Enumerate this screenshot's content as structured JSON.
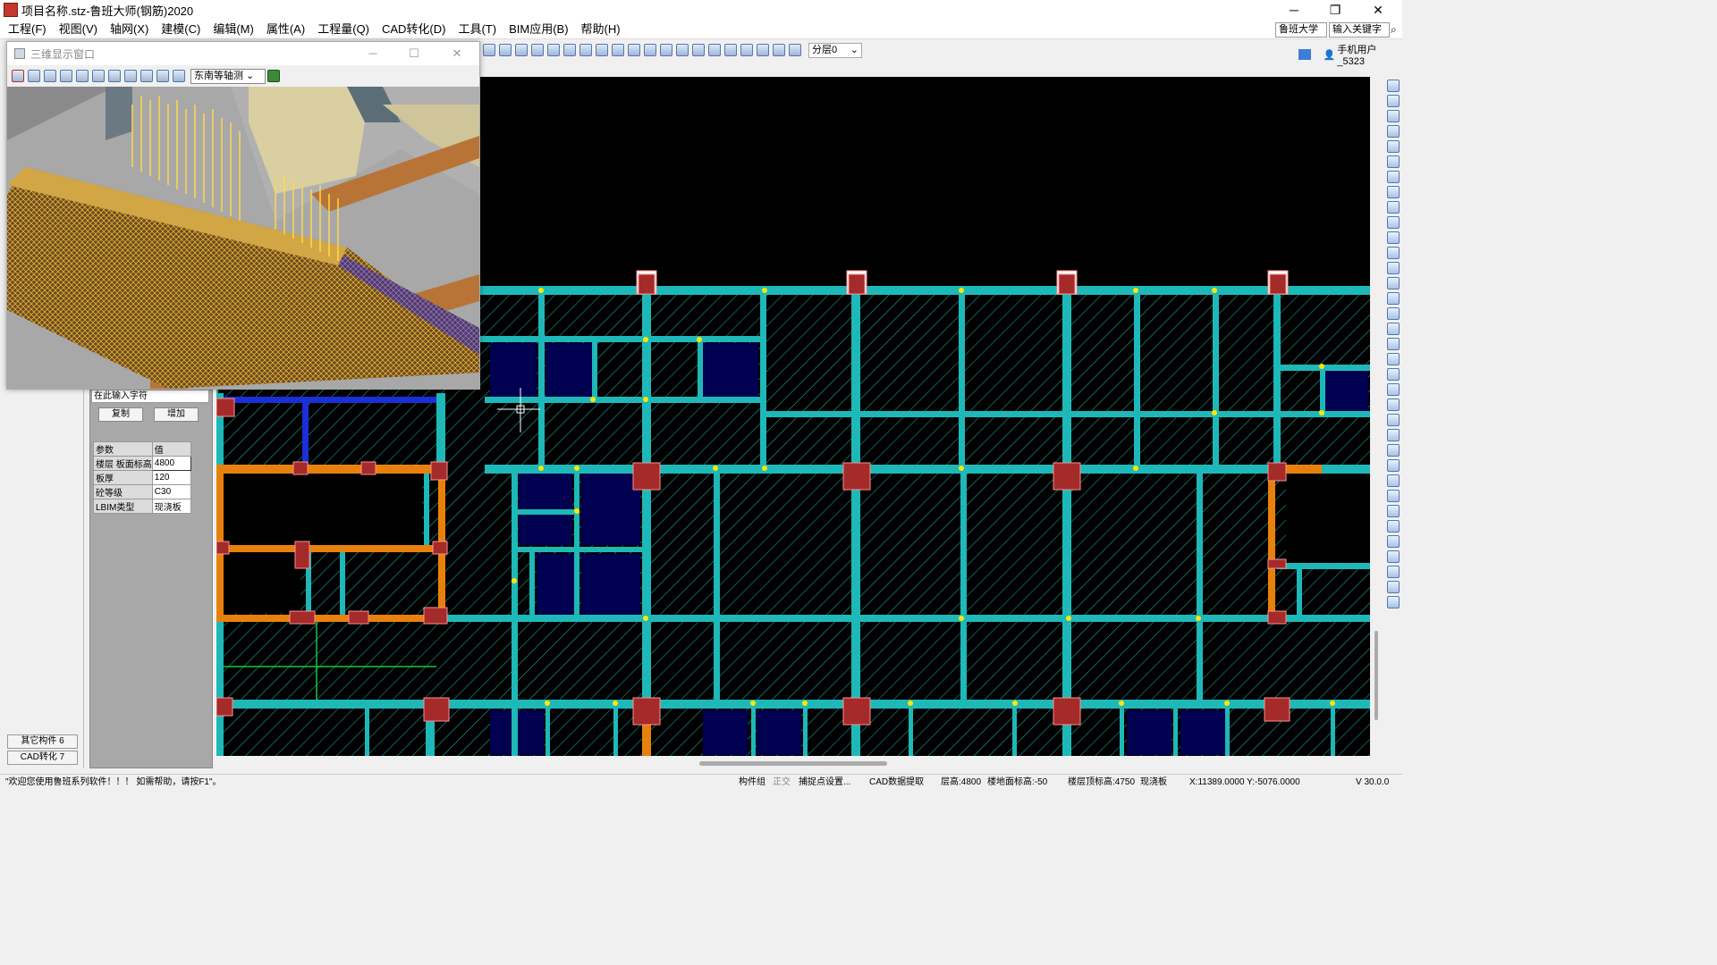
{
  "app": {
    "title": "项目名称.stz-鲁班大师(钢筋)2020"
  },
  "window_controls": {
    "minimize": "─",
    "maximize": "❐",
    "close": "✕"
  },
  "menu": [
    "工程(F)",
    "视图(V)",
    "轴网(X)",
    "建模(C)",
    "编辑(M)",
    "属性(A)",
    "工程量(Q)",
    "CAD转化(D)",
    "工具(T)",
    "BIM应用(B)",
    "帮助(H)"
  ],
  "search": {
    "scope": "鲁班大学",
    "placeholder": "输入关键字"
  },
  "toolbar": {
    "floor_select": "分层0"
  },
  "user": {
    "label": "手机用户_5323"
  },
  "window3d": {
    "title": "三维显示窗口",
    "view_mode": "东南等轴测"
  },
  "left_panel": {
    "filter_placeholder": "在此输入字符",
    "copy_button": "复制",
    "add_button": "增加",
    "table_header": [
      "参数",
      "值"
    ],
    "properties": [
      {
        "key": "楼层 板面标高",
        "value": "4800"
      },
      {
        "key": "板厚",
        "value": "120"
      },
      {
        "key": "砼等级",
        "value": "C30"
      },
      {
        "key": "LBIM类型",
        "value": "现浇板"
      }
    ],
    "side_buttons": [
      {
        "label": "其它构件  6"
      },
      {
        "label": "CAD转化  7"
      }
    ]
  },
  "status": {
    "welcome": "\"欢迎您使用鲁班系列软件！！！  如需帮助，请按F1\"。",
    "component_group": "构件组",
    "ortho": "正交",
    "snap": "捕捉点设置...",
    "cad_extract": "CAD数据提取",
    "floor_height": "层高:4800",
    "ground_elev": "楼地面标高:-50",
    "top_elev": "楼层顶标高:4750",
    "slab_type": "现浇板",
    "coords": "X:11389.0000 Y:-5076.0000",
    "version": "V 30.0.0"
  },
  "colors": {
    "beam": "#1fb8b8",
    "column": "#a52a2a",
    "orange_beam": "#e8810c",
    "blue_beam": "#1a2fd6",
    "hatch": "#1fb8b8"
  }
}
